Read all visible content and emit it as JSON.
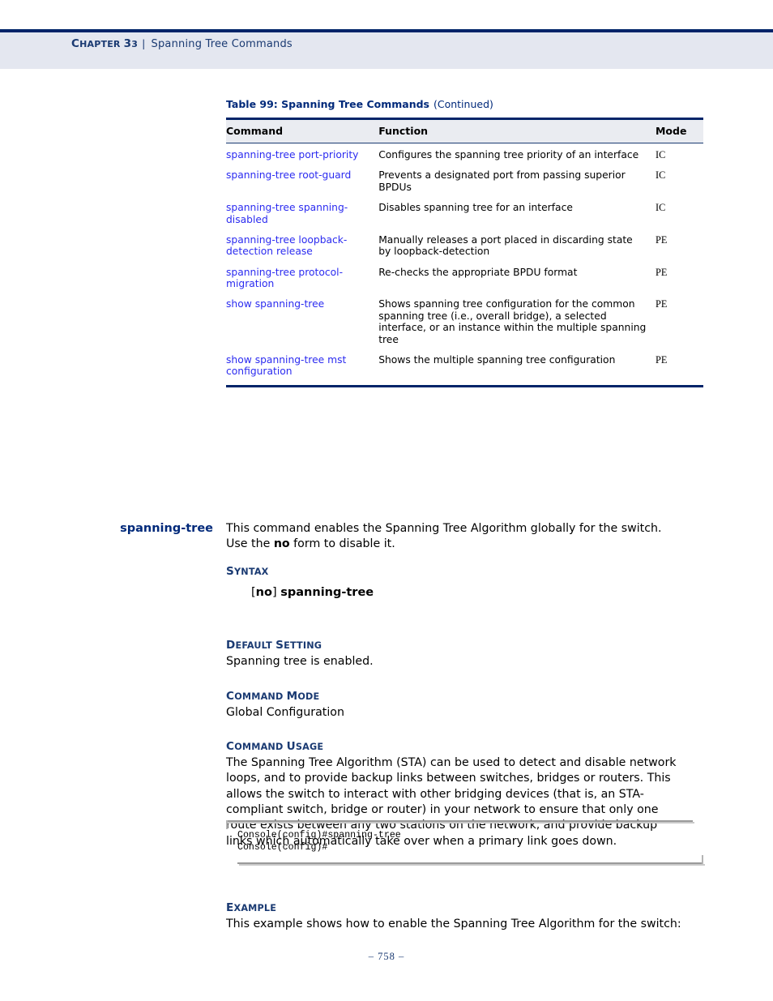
{
  "header": {
    "chapter_label": "Chapter 33",
    "separator": "|",
    "title": "Spanning Tree Commands"
  },
  "table": {
    "caption_main": "Table 99: Spanning Tree Commands",
    "caption_continued": "(Continued)",
    "columns": [
      "Command",
      "Function",
      "Mode"
    ],
    "rows": [
      {
        "command": "spanning-tree port-priority",
        "function": "Configures the spanning tree priority of an interface",
        "mode": "IC"
      },
      {
        "command": "spanning-tree root-guard",
        "function": "Prevents a designated port from passing superior BPDUs",
        "mode": "IC"
      },
      {
        "command": "spanning-tree spanning-disabled",
        "function": "Disables spanning tree for an interface",
        "mode": "IC"
      },
      {
        "command": "spanning-tree loopback-detection release",
        "function": "Manually releases a port placed in discarding state by loopback-detection",
        "mode": "PE"
      },
      {
        "command": "spanning-tree protocol-migration",
        "function": "Re-checks the appropriate BPDU format",
        "mode": "PE"
      },
      {
        "command": "show spanning-tree",
        "function": "Shows spanning tree configuration for the common spanning tree (i.e., overall bridge), a selected interface, or an instance within the multiple spanning tree",
        "mode": "PE"
      },
      {
        "command": "show spanning-tree mst configuration",
        "function": "Shows the multiple spanning tree configuration",
        "mode": "PE"
      }
    ]
  },
  "section": {
    "label": "spanning-tree",
    "intro_part1": "This command enables the Spanning Tree Algorithm globally for the switch. Use the ",
    "intro_bold": "no",
    "intro_part2": " form to disable it.",
    "syntax_heading": "Syntax",
    "syntax_bracket_open": "[",
    "syntax_no": "no",
    "syntax_bracket_close": "]",
    "syntax_command": "spanning-tree",
    "default_setting_heading": "Default Setting",
    "default_setting_text": "Spanning tree is enabled.",
    "command_mode_heading": "Command Mode",
    "command_mode_text": "Global Configuration",
    "command_usage_heading": "Command Usage",
    "command_usage_text": "The Spanning Tree Algorithm (STA) can be used to detect and disable network loops, and to provide backup links between switches, bridges or routers. This allows the switch to interact with other bridging devices (that is, an STA-compliant switch, bridge or router) in your network to ensure that only one route exists between any two stations on the network, and provide backup links which automatically take over when a primary link goes down.",
    "example_heading": "Example",
    "example_text": "This example shows how to enable the Spanning Tree Algorithm for the switch:"
  },
  "console": {
    "text": "Console(config)#spanning-tree\nConsole(config)#"
  },
  "footer": {
    "page_number": "–  758  –"
  },
  "colors": {
    "navy_rule": "#002469",
    "header_band": "#e4e7f0",
    "heading_navy": "#00297a",
    "link_blue": "#2b2bf0",
    "table_header_bg": "#eaecf1"
  }
}
